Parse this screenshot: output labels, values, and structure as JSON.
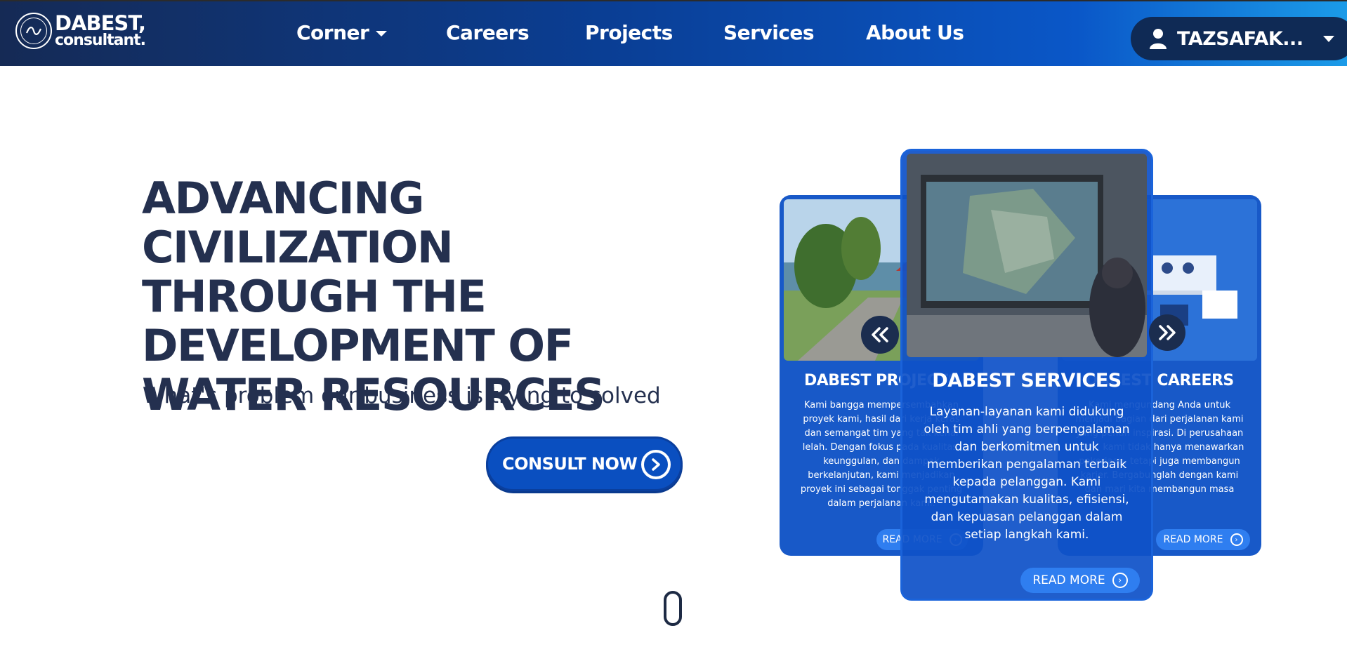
{
  "brand": {
    "line1": "DABEST,",
    "line2": "consultant."
  },
  "nav": {
    "items": [
      {
        "label": "Corner",
        "dropdown": true
      },
      {
        "label": "Careers"
      },
      {
        "label": "Projects"
      },
      {
        "label": "Services"
      },
      {
        "label": "About Us"
      }
    ]
  },
  "user": {
    "name": "TAZSAFAK...",
    "icon": "user-icon"
  },
  "hero": {
    "title": "ADVANCING CIVILIZATION THROUGH THE DEVELOPMENT OF WATER RESOURCES",
    "subtitle": "What's problem our business is trying to solved",
    "cta": "CONSULT NOW"
  },
  "cards": {
    "left": {
      "title": "DABEST PROJECTS",
      "body": "Kami bangga mempersembahkan proyek kami, hasil dari kerja keras dan semangat tim yang tak kenal lelah. Dengan fokus pada kualitas, keunggulan, dan dampak berkelanjutan, kami menjadikan proyek ini sebagai tonggak penting dalam perjalanan kami.",
      "read_more": "READ MORE"
    },
    "center": {
      "title": "DABEST SERVICES",
      "body": "Layanan-layanan kami didukung oleh tim ahli yang berpengalaman dan berkomitmen untuk memberikan pengalaman terbaik kepada pelanggan. Kami mengutamakan kualitas, efisiensi, dan kepuasan pelanggan dalam setiap langkah kami.",
      "read_more": "READ MORE"
    },
    "right": {
      "title": "DABEST CAREERS",
      "body": "Kami mengundang Anda untuk menjadi bagian dari perjalanan kami yang penuh inspirasi. Di perusahaan kami, kami tidak hanya menawarkan pekerjaan, tetapi juga membangun karier. Bergabunglah dengan kami dan mari kita membangun masa",
      "read_more": "READ MORE"
    }
  },
  "colors": {
    "navy": "#24304f",
    "brand_blue": "#0a4fc0",
    "card_blue": "#1859c8"
  }
}
